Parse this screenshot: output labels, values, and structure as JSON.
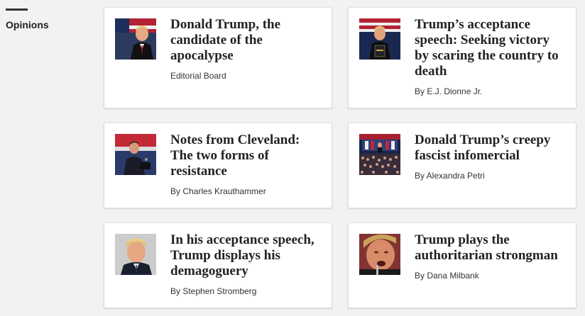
{
  "section": {
    "label": "Opinions"
  },
  "articles": [
    {
      "headline": "Donald Trump, the candidate of the apocalypse",
      "byline": "Editorial Board",
      "thumb_icon": "trump-podium-photo"
    },
    {
      "headline": "Trump’s acceptance speech: Seeking victory by scaring the country to death",
      "byline": "By E.J. Dionne Jr.",
      "thumb_icon": "trump-stage-photo"
    },
    {
      "headline": "Notes from Cleveland: The two forms of resistance",
      "byline": "By Charles Krauthammer",
      "thumb_icon": "cruz-speech-photo"
    },
    {
      "headline": "Donald Trump’s creepy fascist infomercial",
      "byline": "By Alexandra Petri",
      "thumb_icon": "convention-crowd-photo"
    },
    {
      "headline": "In his acceptance speech, Trump displays his demagoguery",
      "byline": "By Stephen Stromberg",
      "thumb_icon": "trump-portrait-photo"
    },
    {
      "headline": "Trump plays the authoritarian strongman",
      "byline": "By Dana Milbank",
      "thumb_icon": "trump-closeup-photo"
    }
  ]
}
